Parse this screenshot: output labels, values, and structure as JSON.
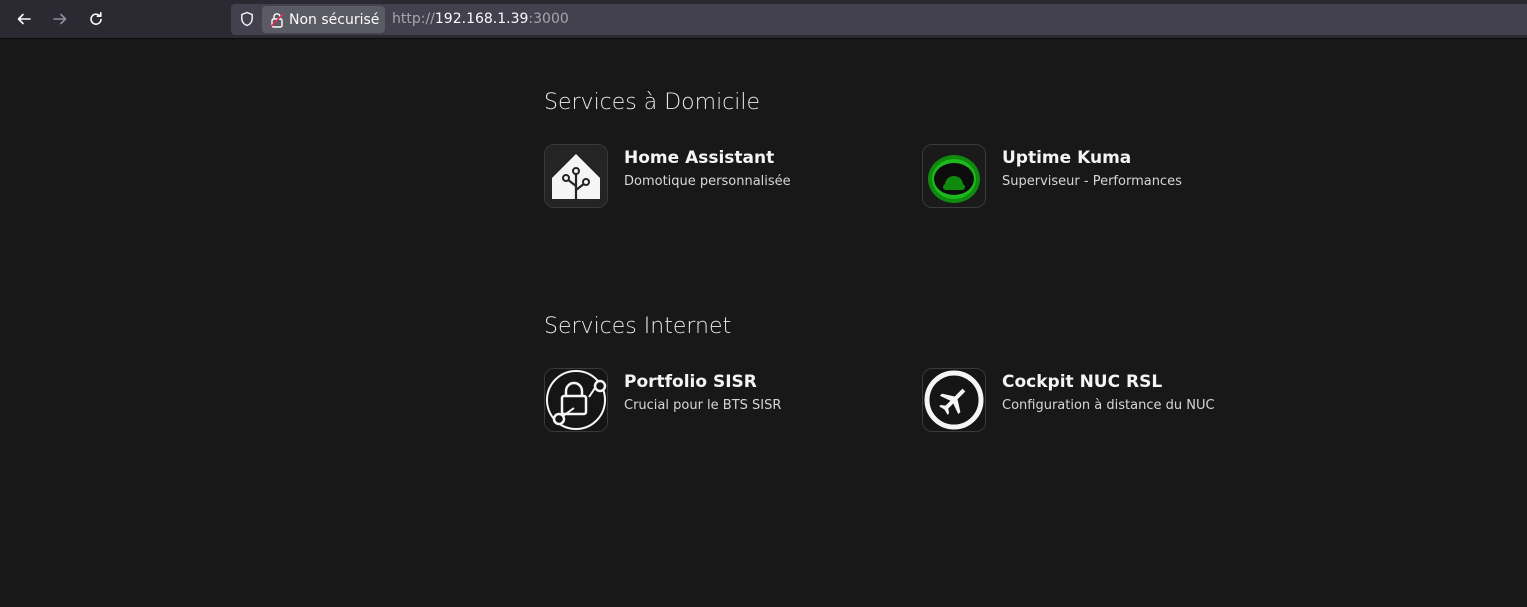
{
  "browser": {
    "back_icon": "arrow-left-icon",
    "forward_icon": "arrow-right-icon",
    "reload_icon": "reload-icon",
    "security_label": "Non sécurisé",
    "url_scheme": "http://",
    "url_host": "192.168.1.39",
    "url_port": ":3000"
  },
  "sections": [
    {
      "title": "Services à Domicile",
      "items": [
        {
          "name": "Home Assistant",
          "description": "Domotique personnalisée",
          "icon": "home-assistant-icon"
        },
        {
          "name": "Uptime Kuma",
          "description": "Superviseur - Performances",
          "icon": "uptime-kuma-icon"
        }
      ]
    },
    {
      "title": "Services Internet",
      "items": [
        {
          "name": "Portfolio SISR",
          "description": "Crucial pour le BTS SISR",
          "icon": "network-lock-icon"
        },
        {
          "name": "Cockpit NUC RSL",
          "description": "Configuration à distance du NUC",
          "icon": "airplane-icon"
        }
      ]
    }
  ],
  "colors": {
    "background": "#181818",
    "toolbar": "#2b2a33",
    "urlbar": "#42414d",
    "kuma_green": "#1dba1d"
  }
}
